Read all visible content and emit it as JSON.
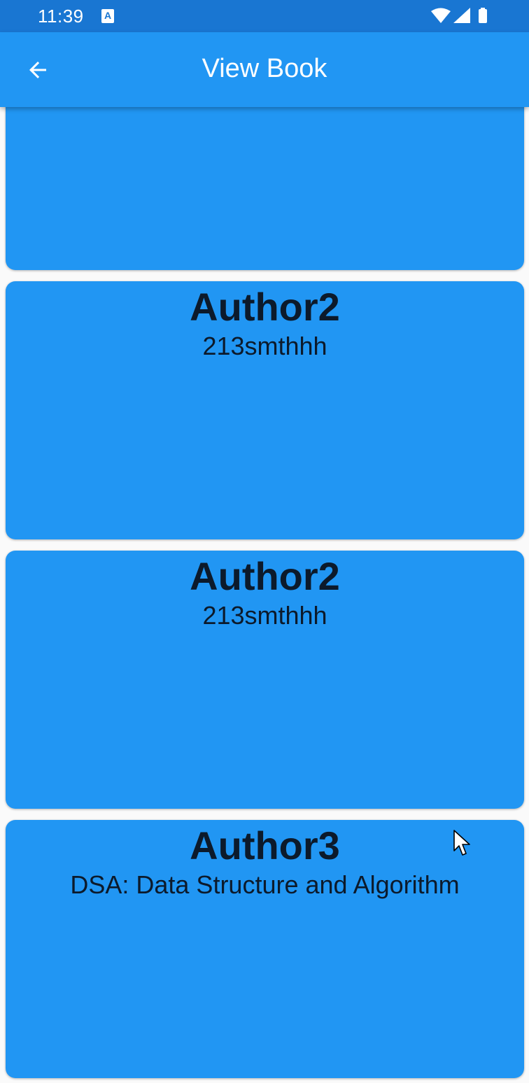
{
  "status_bar": {
    "time": "11:39",
    "notification_glyph": "A",
    "icons": [
      "wifi-icon",
      "cell-signal-icon",
      "battery-icon"
    ]
  },
  "app_bar": {
    "title": "View Book",
    "back_icon": "arrow-back-icon",
    "color": "#2196f3"
  },
  "cards": [
    {
      "author": "",
      "book": ""
    },
    {
      "author": "Author2",
      "book": "213smthhh"
    },
    {
      "author": "Author2",
      "book": "213smthhh"
    },
    {
      "author": "Author3",
      "book": "DSA: Data Structure and Algorithm"
    }
  ],
  "colors": {
    "status_bar": "#1976d2",
    "card": "#2196f3",
    "text_dark": "#0c1a2b"
  }
}
